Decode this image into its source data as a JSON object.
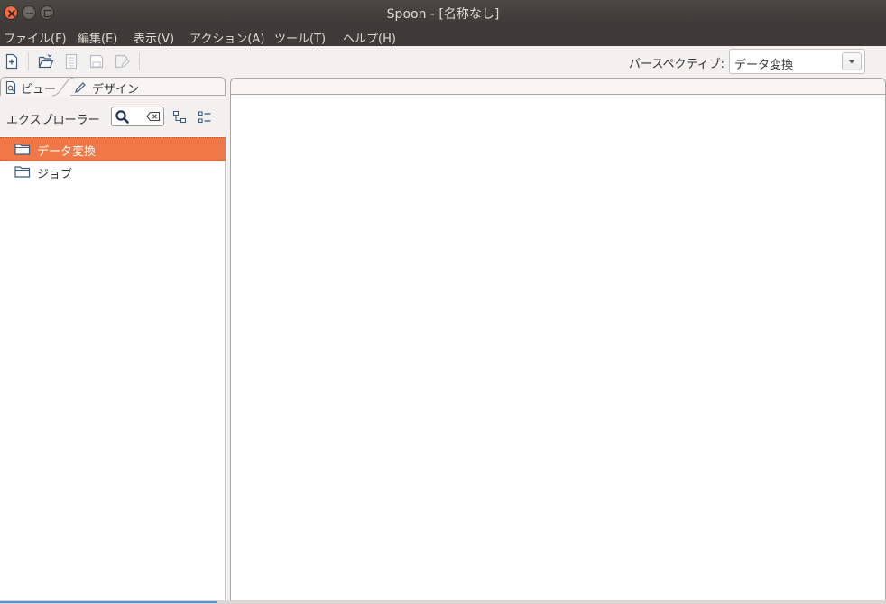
{
  "window": {
    "title": "Spoon - [名称なし]"
  },
  "menu": {
    "items": [
      "ファイル(F)",
      "編集(E)",
      "表示(V)",
      "アクション(A)",
      "ツール(T)",
      "ヘルプ(H)"
    ]
  },
  "toolbar": {
    "icons": [
      "new-file-icon",
      "open-folder-icon",
      "explore-repository-icon",
      "save-icon",
      "save-as-icon"
    ],
    "perspective_label": "パースペクティブ:",
    "perspective_value": "データ変換"
  },
  "left_panel": {
    "tabs": [
      {
        "label": "ビュー",
        "icon": "view-icon"
      },
      {
        "label": "デザイン",
        "icon": "pencil-icon"
      }
    ],
    "explorer_label": "エクスプローラー",
    "tree": [
      {
        "label": "データ変換",
        "icon": "folder-icon",
        "selected": true
      },
      {
        "label": "ジョブ",
        "icon": "folder-icon",
        "selected": false
      }
    ]
  },
  "colors": {
    "titlebar": "#3c3b37",
    "selection": "#f07746",
    "close_button": "#e4572e"
  }
}
